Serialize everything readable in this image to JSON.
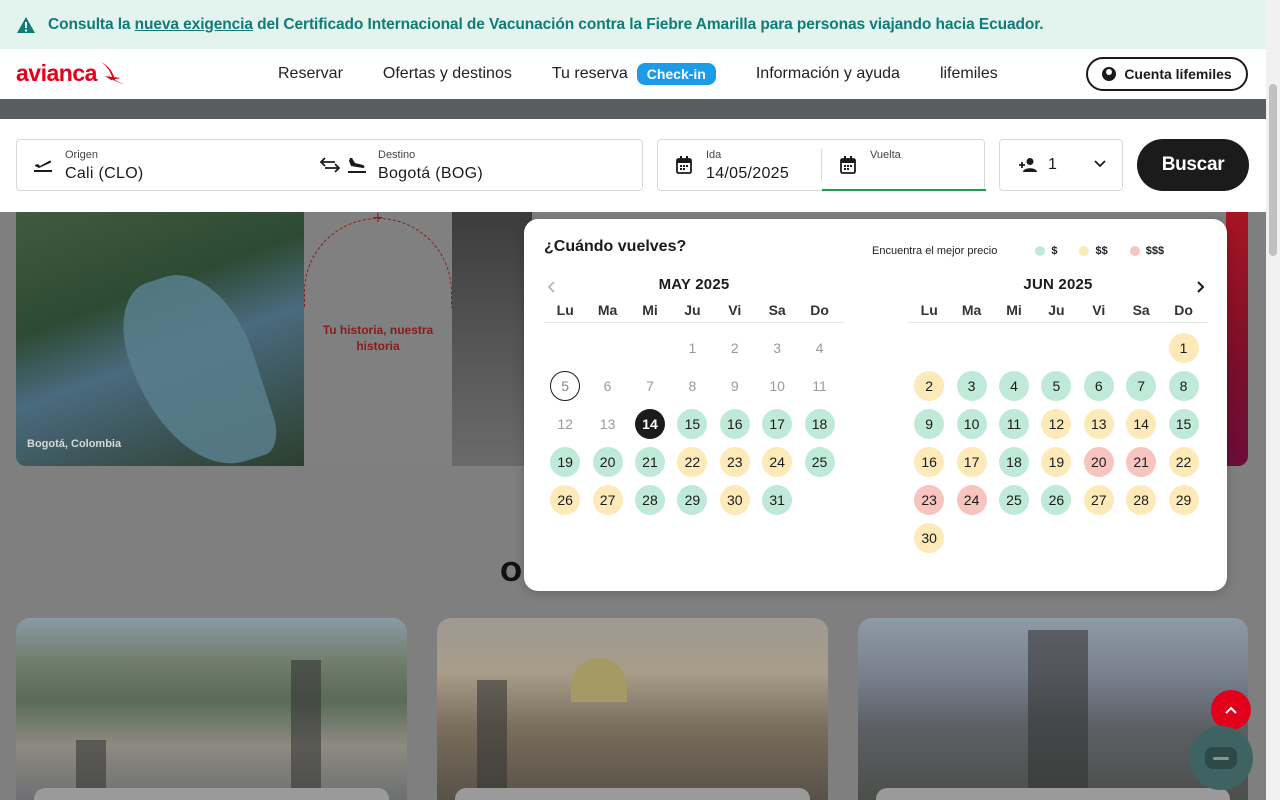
{
  "banner": {
    "text_before": "Consulta la ",
    "link": "nueva exigencia",
    "text_after": " del Certificado Internacional de Vacunación contra la Fiebre Amarilla para personas viajando hacia Ecuador."
  },
  "header": {
    "logo": "avianca",
    "nav": {
      "reservar": "Reservar",
      "ofertas": "Ofertas y destinos",
      "tu_reserva": "Tu reserva",
      "checkin": "Check-in",
      "info": "Información y ayuda",
      "lifemiles": "lifemiles"
    },
    "account_button": "Cuenta lifemiles"
  },
  "hero": {
    "caption": "Bogotá, Colombia",
    "story": "Tu historia, nuestra historia",
    "section_title_fragment": "O"
  },
  "search": {
    "origin_label": "Origen",
    "origin_value": "Cali (CLO)",
    "destination_label": "Destino",
    "destination_value": "Bogotá (BOG)",
    "ida_label": "Ida",
    "ida_value": "14/05/2025",
    "vuelta_label": "Vuelta",
    "vuelta_value": "",
    "passengers": "1",
    "search_button": "Buscar"
  },
  "calendar": {
    "question": "¿Cuándo vuelves?",
    "legend_title": "Encuentra el mejor precio",
    "legend": [
      {
        "label": "$",
        "color": "#bfe9d8"
      },
      {
        "label": "$$",
        "color": "#fdeab8"
      },
      {
        "label": "$$$",
        "color": "#f7c4c0"
      }
    ],
    "weekdays": [
      "Lu",
      "Ma",
      "Mi",
      "Ju",
      "Vi",
      "Sa",
      "Do"
    ],
    "months": [
      {
        "title": "MAY 2025",
        "offset": 3,
        "days": [
          {
            "d": "1",
            "s": "dis"
          },
          {
            "d": "2",
            "s": "dis"
          },
          {
            "d": "3",
            "s": "dis"
          },
          {
            "d": "4",
            "s": "dis"
          },
          {
            "d": "5",
            "s": "today"
          },
          {
            "d": "6",
            "s": "dis"
          },
          {
            "d": "7",
            "s": "dis"
          },
          {
            "d": "8",
            "s": "dis"
          },
          {
            "d": "9",
            "s": "dis"
          },
          {
            "d": "10",
            "s": "dis"
          },
          {
            "d": "11",
            "s": "dis"
          },
          {
            "d": "12",
            "s": "dis"
          },
          {
            "d": "13",
            "s": "dis"
          },
          {
            "d": "14",
            "s": "sel"
          },
          {
            "d": "15",
            "s": "c1"
          },
          {
            "d": "16",
            "s": "c1"
          },
          {
            "d": "17",
            "s": "c1"
          },
          {
            "d": "18",
            "s": "c1"
          },
          {
            "d": "19",
            "s": "c1"
          },
          {
            "d": "20",
            "s": "c1"
          },
          {
            "d": "21",
            "s": "c1"
          },
          {
            "d": "22",
            "s": "c2"
          },
          {
            "d": "23",
            "s": "c2"
          },
          {
            "d": "24",
            "s": "c2"
          },
          {
            "d": "25",
            "s": "c1"
          },
          {
            "d": "26",
            "s": "c2"
          },
          {
            "d": "27",
            "s": "c2"
          },
          {
            "d": "28",
            "s": "c1"
          },
          {
            "d": "29",
            "s": "c1"
          },
          {
            "d": "30",
            "s": "c2"
          },
          {
            "d": "31",
            "s": "c1"
          }
        ]
      },
      {
        "title": "JUN 2025",
        "offset": 6,
        "days": [
          {
            "d": "1",
            "s": "c2"
          },
          {
            "d": "2",
            "s": "c2"
          },
          {
            "d": "3",
            "s": "c1"
          },
          {
            "d": "4",
            "s": "c1"
          },
          {
            "d": "5",
            "s": "c1"
          },
          {
            "d": "6",
            "s": "c1"
          },
          {
            "d": "7",
            "s": "c1"
          },
          {
            "d": "8",
            "s": "c1"
          },
          {
            "d": "9",
            "s": "c1"
          },
          {
            "d": "10",
            "s": "c1"
          },
          {
            "d": "11",
            "s": "c1"
          },
          {
            "d": "12",
            "s": "c2"
          },
          {
            "d": "13",
            "s": "c2"
          },
          {
            "d": "14",
            "s": "c2"
          },
          {
            "d": "15",
            "s": "c1"
          },
          {
            "d": "16",
            "s": "c2"
          },
          {
            "d": "17",
            "s": "c2"
          },
          {
            "d": "18",
            "s": "c1"
          },
          {
            "d": "19",
            "s": "c2"
          },
          {
            "d": "20",
            "s": "c3"
          },
          {
            "d": "21",
            "s": "c3"
          },
          {
            "d": "22",
            "s": "c2"
          },
          {
            "d": "23",
            "s": "c3"
          },
          {
            "d": "24",
            "s": "c3"
          },
          {
            "d": "25",
            "s": "c1"
          },
          {
            "d": "26",
            "s": "c1"
          },
          {
            "d": "27",
            "s": "c2"
          },
          {
            "d": "28",
            "s": "c2"
          },
          {
            "d": "29",
            "s": "c2"
          },
          {
            "d": "30",
            "s": "c2"
          }
        ]
      }
    ]
  }
}
